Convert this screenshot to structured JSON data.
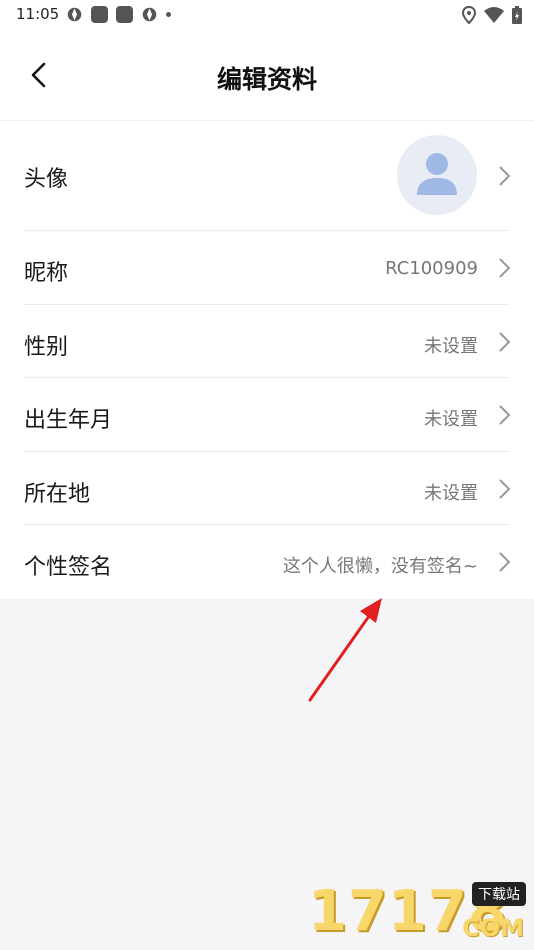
{
  "status_bar": {
    "time": "11:05"
  },
  "header": {
    "title": "编辑资料"
  },
  "rows": [
    {
      "label": "头像",
      "value": ""
    },
    {
      "label": "昵称",
      "value": "RC100909"
    },
    {
      "label": "性别",
      "value": "未设置"
    },
    {
      "label": "出生年月",
      "value": "未设置"
    },
    {
      "label": "所在地",
      "value": "未设置"
    },
    {
      "label": "个性签名",
      "value": "这个人很懒，没有签名~"
    }
  ],
  "watermark": {
    "brand": "17178",
    "badge": "下载站",
    "suffix": "COM"
  },
  "colors": {
    "page_bg": "#f5f5f7",
    "card_bg": "#ffffff",
    "avatar_bg": "#e8ecf4",
    "avatar_fg": "#9fb8e6",
    "annotation_red": "#e02020"
  }
}
